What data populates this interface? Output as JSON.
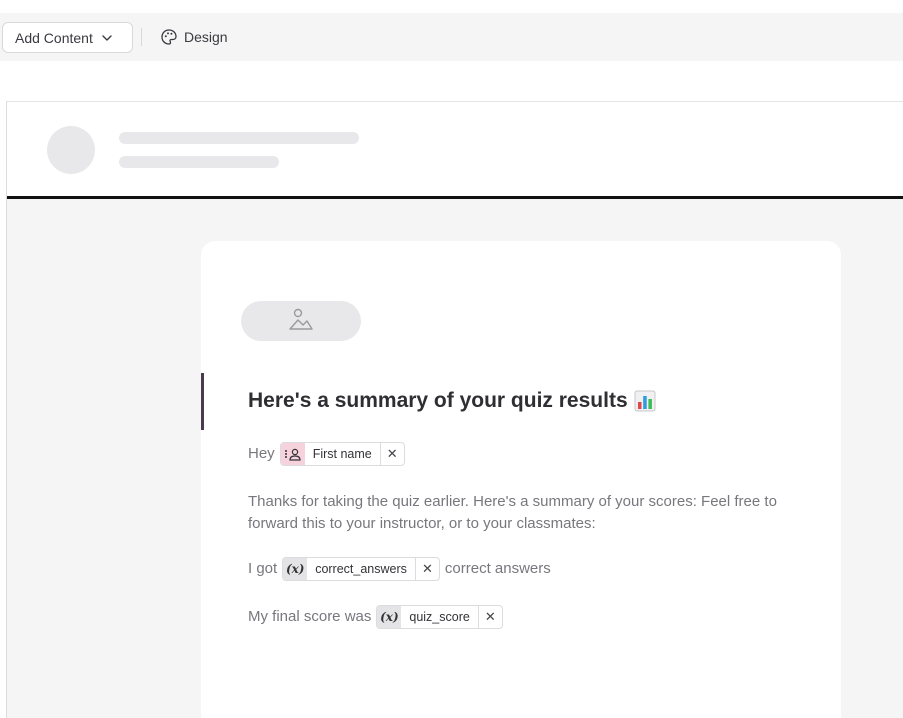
{
  "toolbar": {
    "add_content_label": "Add Content",
    "design_label": "Design"
  },
  "email": {
    "title": "Here's a summary of your quiz results",
    "title_emoji_icon": "bar-chart-emoji",
    "greeting_prefix": "Hey",
    "first_name_chip": {
      "icon": "contact-field-icon",
      "label": "First name"
    },
    "body_text": "Thanks for taking the quiz earlier. Here's a summary of your scores: Feel free to forward this to your instructor, or to your classmates:",
    "correct_prefix": "I got",
    "correct_chip": {
      "icon": "variable-icon",
      "symbol": "(x)",
      "label": "correct_answers"
    },
    "correct_suffix": "correct answers",
    "score_prefix": "My final score was",
    "score_chip": {
      "icon": "variable-icon",
      "symbol": "(x)",
      "label": "quiz_score"
    }
  },
  "colors": {
    "accent_contact": "#f6d3dc",
    "variable_chip_bg": "#e4e4e7",
    "canvas_bg": "#f5f5f6"
  }
}
